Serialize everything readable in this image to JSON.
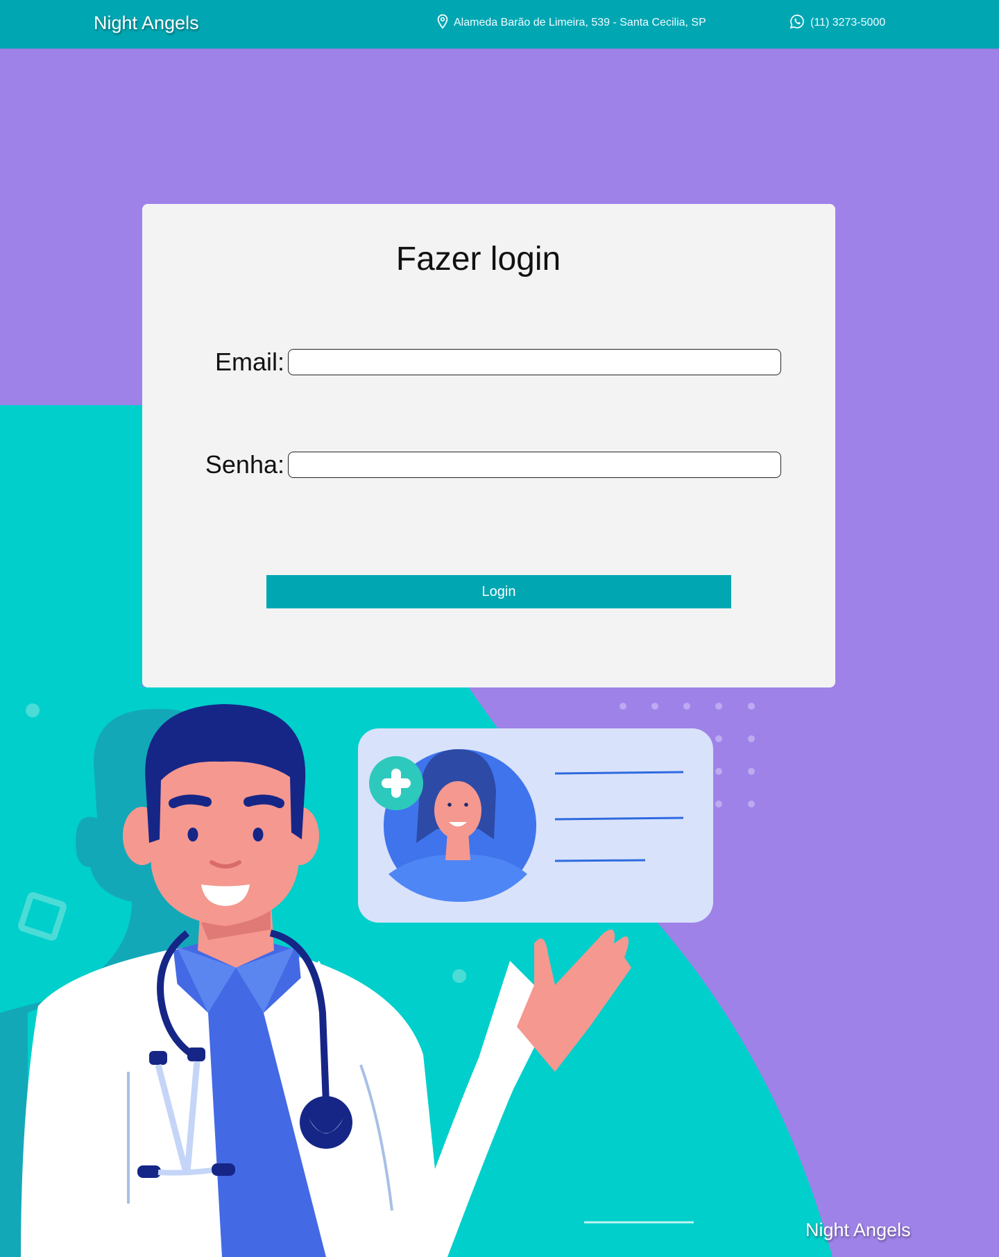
{
  "header": {
    "brand": "Night Angels",
    "address": "Alameda Barão de Limeira, 539 - Santa Cecilia, SP",
    "phone": "(11) 3273-5000",
    "address_icon": "location-pin-icon",
    "phone_icon": "whatsapp-icon"
  },
  "login_form": {
    "title": "Fazer login",
    "email_label": "Email:",
    "email_value": "",
    "password_label": "Senha:",
    "password_value": "",
    "submit_label": "Login"
  },
  "footer": {
    "brand": "Night Angels"
  },
  "colors": {
    "header_bg": "#00a7b3",
    "page_bg": "#9f82e8",
    "teal_shape": "#00cfcb",
    "card_bg": "#f3f3f3",
    "button_bg": "#00a7b3"
  }
}
